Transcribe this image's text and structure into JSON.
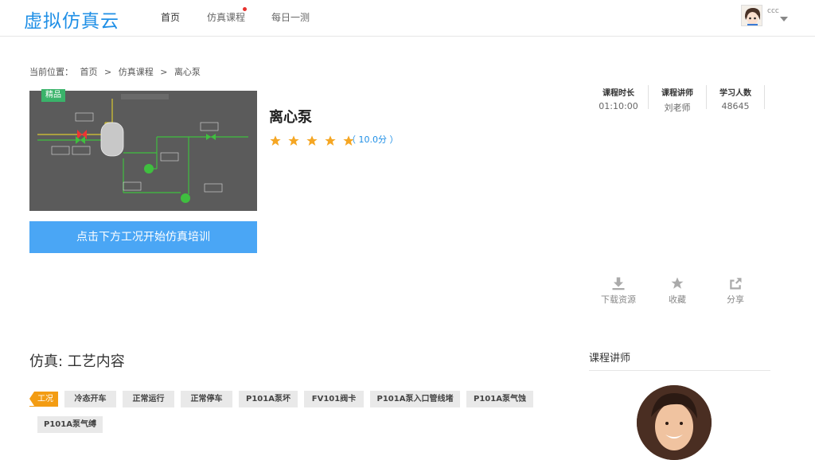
{
  "header": {
    "logo": "虚拟仿真云",
    "nav": [
      {
        "label": "首页",
        "active": true
      },
      {
        "label": "仿真课程",
        "active": false,
        "dot": true
      },
      {
        "label": "每日一测",
        "active": false
      }
    ],
    "user": {
      "name": "ccc"
    }
  },
  "breadcrumb": {
    "prefix": "当前位置：",
    "items": [
      "首页",
      ">",
      "仿真课程",
      ">",
      "离心泵"
    ]
  },
  "course": {
    "badge": "精品",
    "title": "离心泵",
    "rating_text": "（ 10.0分 ）",
    "stars": 5,
    "start_button": "点击下方工况开始仿真培训"
  },
  "stats": [
    {
      "label": "课程时长",
      "value": "01:10:00"
    },
    {
      "label": "课程讲师",
      "value": "刘老师"
    },
    {
      "label": "学习人数",
      "value": "48645"
    }
  ],
  "actions": [
    {
      "label": "下载资源",
      "icon": "download-icon"
    },
    {
      "label": "收藏",
      "icon": "star-icon"
    },
    {
      "label": "分享",
      "icon": "share-icon"
    }
  ],
  "section": {
    "title": "仿真: 工艺内容",
    "tag_label": "工况",
    "tags": [
      "冷态开车",
      "正常运行",
      "正常停车",
      "P101A泵坏",
      "FV101阀卡",
      "P101A泵入口管线堵",
      "P101A泵气蚀",
      "P101A泵气缚"
    ]
  },
  "sidebar": {
    "title": "课程讲师"
  },
  "colors": {
    "brand": "#1f8fe6",
    "button": "#4aa6f5",
    "star": "#f5a623",
    "tag_label": "#f39c12",
    "badge": "#3ab36a"
  }
}
